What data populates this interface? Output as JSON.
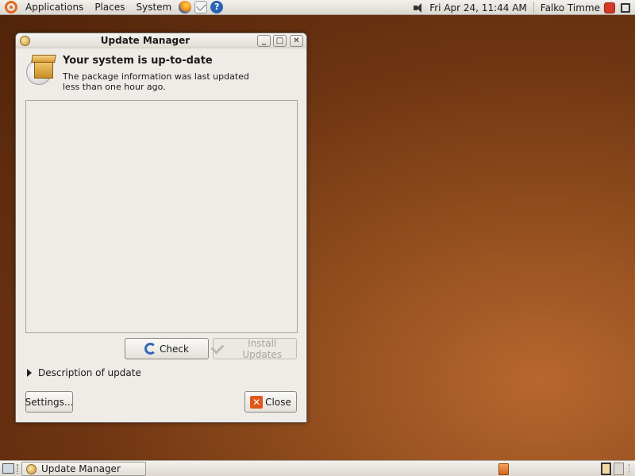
{
  "top_panel": {
    "menus": [
      "Applications",
      "Places",
      "System"
    ],
    "clock": "Fri Apr 24, 11:44 AM",
    "user": "Falko Timme"
  },
  "window": {
    "title": "Update Manager",
    "headline": "Your system is up-to-date",
    "subtext": "The package information was last updated less than one hour ago.",
    "buttons": {
      "check": "Check",
      "install": "Install Updates",
      "settings": "Settings...",
      "close": "Close"
    },
    "expander": "Description of update"
  },
  "bottom_panel": {
    "task": "Update Manager"
  }
}
